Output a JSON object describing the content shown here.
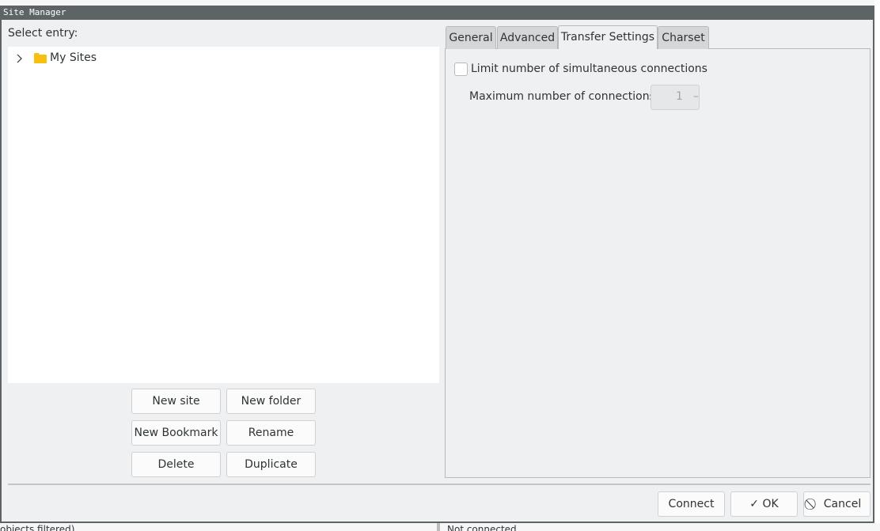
{
  "window": {
    "title": "Site Manager"
  },
  "left": {
    "label": "Select entry:",
    "tree": [
      {
        "label": "My Sites",
        "icon": "folder-icon",
        "color": "#f9bf10"
      }
    ],
    "buttons": {
      "new_site": "New site",
      "new_folder": "New folder",
      "new_bookmark": "New Bookmark",
      "rename": "Rename",
      "delete": "Delete",
      "duplicate": "Duplicate"
    }
  },
  "tabs": [
    {
      "label": "General"
    },
    {
      "label": "Advanced"
    },
    {
      "label": "Transfer Settings",
      "active": true
    },
    {
      "label": "Charset"
    }
  ],
  "transfer": {
    "limit_label": "Limit number of simultaneous connections",
    "limit_checked": false,
    "max_label": "Maximum number of connections:",
    "max_value": "1"
  },
  "footer": {
    "connect": "Connect",
    "ok": "OK",
    "cancel": "Cancel"
  },
  "background": {
    "status_left": "objects filtered)",
    "status_right": "Not connected"
  }
}
